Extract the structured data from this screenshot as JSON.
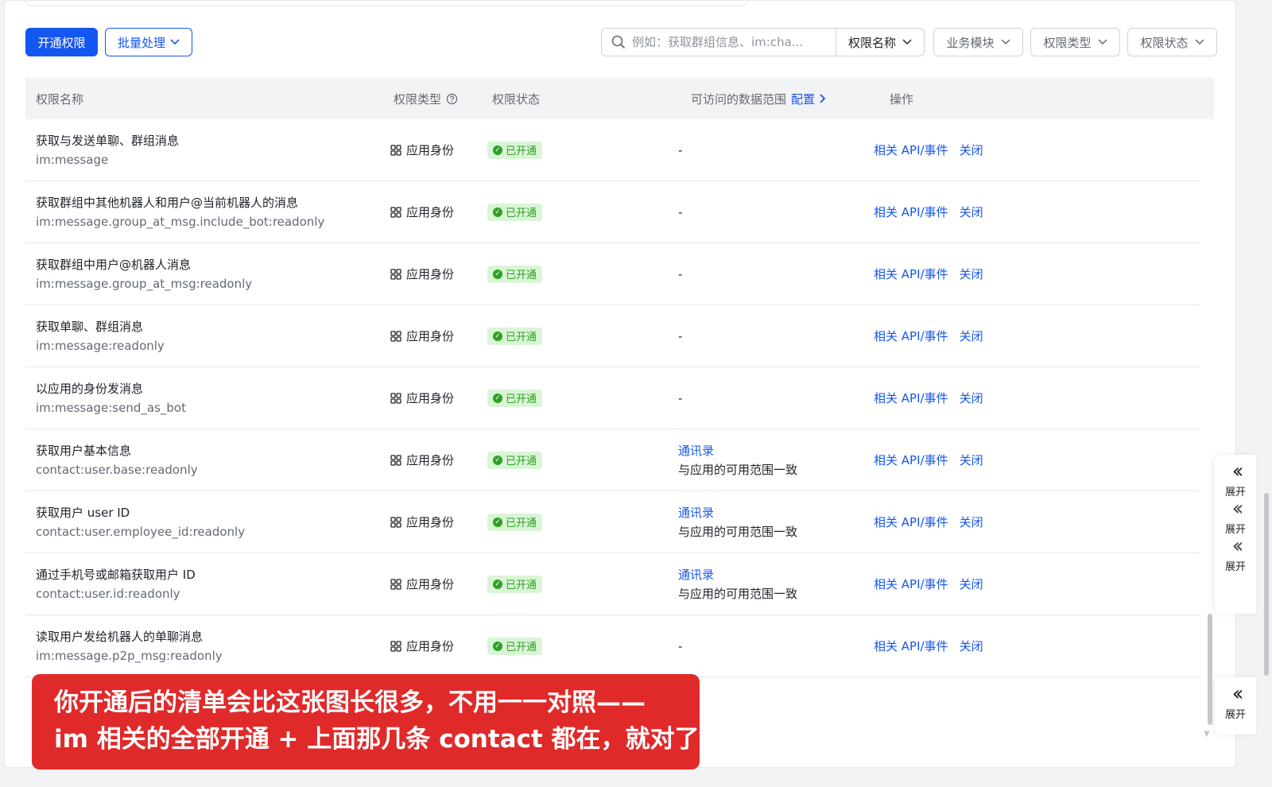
{
  "toolbar": {
    "enable_button": "开通权限",
    "batch_button": "批量处理",
    "search_placeholder": "例如：获取群组信息、im:cha...",
    "filters": [
      "权限名称",
      "业务模块",
      "权限类型",
      "权限状态"
    ]
  },
  "table": {
    "headers": {
      "name": "权限名称",
      "type": "权限类型",
      "status": "权限状态",
      "scope": "可访问的数据范围",
      "scope_config": "配置",
      "ops": "操作"
    },
    "rows": [
      {
        "name": "获取与发送单聊、群组消息",
        "code": "im:message",
        "type": "应用身份",
        "status": "已开通",
        "scope_link": "",
        "scope_text": "-",
        "op_api": "相关 API/事件",
        "op_close": "关闭"
      },
      {
        "name": "获取群组中其他机器人和用户@当前机器人的消息",
        "code": "im:message.group_at_msg.include_bot:readonly",
        "type": "应用身份",
        "status": "已开通",
        "scope_link": "",
        "scope_text": "-",
        "op_api": "相关 API/事件",
        "op_close": "关闭"
      },
      {
        "name": "获取群组中用户@机器人消息",
        "code": "im:message.group_at_msg:readonly",
        "type": "应用身份",
        "status": "已开通",
        "scope_link": "",
        "scope_text": "-",
        "op_api": "相关 API/事件",
        "op_close": "关闭"
      },
      {
        "name": "获取单聊、群组消息",
        "code": "im:message:readonly",
        "type": "应用身份",
        "status": "已开通",
        "scope_link": "",
        "scope_text": "-",
        "op_api": "相关 API/事件",
        "op_close": "关闭"
      },
      {
        "name": "以应用的身份发消息",
        "code": "im:message:send_as_bot",
        "type": "应用身份",
        "status": "已开通",
        "scope_link": "",
        "scope_text": "-",
        "op_api": "相关 API/事件",
        "op_close": "关闭"
      },
      {
        "name": "获取用户基本信息",
        "code": "contact:user.base:readonly",
        "type": "应用身份",
        "status": "已开通",
        "scope_link": "通讯录",
        "scope_text": "与应用的可用范围一致",
        "op_api": "相关 API/事件",
        "op_close": "关闭"
      },
      {
        "name": "获取用户 user ID",
        "code": "contact:user.employee_id:readonly",
        "type": "应用身份",
        "status": "已开通",
        "scope_link": "通讯录",
        "scope_text": "与应用的可用范围一致",
        "op_api": "相关 API/事件",
        "op_close": "关闭"
      },
      {
        "name": "通过手机号或邮箱获取用户 ID",
        "code": "contact:user.id:readonly",
        "type": "应用身份",
        "status": "已开通",
        "scope_link": "通讯录",
        "scope_text": "与应用的可用范围一致",
        "op_api": "相关 API/事件",
        "op_close": "关闭"
      },
      {
        "name": "读取用户发给机器人的单聊消息",
        "code": "im:message.p2p_msg:readonly",
        "type": "应用身份",
        "status": "已开通",
        "scope_link": "",
        "scope_text": "-",
        "op_api": "相关 API/事件",
        "op_close": "关闭"
      }
    ]
  },
  "side_panel": {
    "expand_label": "展开"
  },
  "caption": {
    "line1": "你开通后的清单会比这张图长很多，不用一一对照——",
    "line2": "im 相关的全部开通 + 上面那几条 contact 都在，就对了"
  },
  "colors": {
    "primary": "#1456f0",
    "success_bg": "#d9f5d6",
    "success_text": "#2ea121",
    "caption_bg": "#e02a2a"
  }
}
